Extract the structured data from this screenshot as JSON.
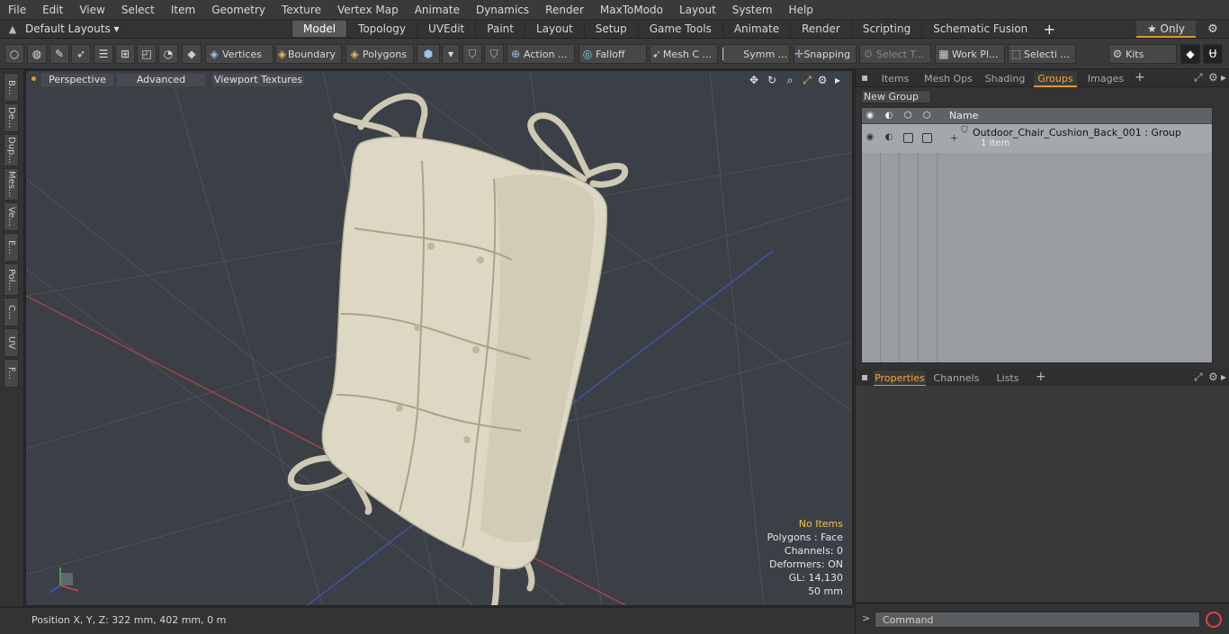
{
  "menu": [
    "File",
    "Edit",
    "View",
    "Select",
    "Item",
    "Geometry",
    "Texture",
    "Vertex Map",
    "Animate",
    "Dynamics",
    "Render",
    "MaxToModo",
    "Layout",
    "System",
    "Help"
  ],
  "layout_bar": {
    "layouts_label": "Default Layouts ▾",
    "tabs": [
      "Model",
      "Topology",
      "UVEdit",
      "Paint",
      "Layout",
      "Setup",
      "Game Tools",
      "Animate",
      "Render",
      "Scripting",
      "Schematic Fusion"
    ],
    "active_tab": "Model",
    "add": "+",
    "only_label": "★ Only"
  },
  "toolbar": {
    "vertices": "Vertices",
    "boundary": "Boundary",
    "polygons": "Polygons",
    "action": "Action ...",
    "falloff": "Falloff",
    "mesh": "Mesh C ...",
    "symm": "Symm ...",
    "snapping": "Snapping",
    "select_t": "Select T...",
    "work_plane": "Work Pl...",
    "selection": "Selecti ...",
    "kits": "Kits"
  },
  "left_tabs": [
    "B...",
    "De...",
    "Dup...",
    "Mes...",
    "Ve...",
    "E...",
    "Pol...",
    "C...",
    "UV",
    "F..."
  ],
  "viewport": {
    "perspective": "Perspective",
    "advanced": "Advanced",
    "viewport_textures": "Viewport Textures",
    "info": {
      "no_items": "No Items",
      "polygons": "Polygons : Face",
      "channels": "Channels: 0",
      "deformers": "Deformers: ON",
      "gl": "GL: 14,130",
      "size": "50 mm"
    }
  },
  "status": {
    "position": "Position X, Y, Z:   322 mm, 402 mm, 0 m"
  },
  "right_panel": {
    "top_tabs": [
      "Items",
      "Mesh Ops",
      "Shading",
      "Groups",
      "Images"
    ],
    "active_top_tab": "Groups",
    "new_group": "New Group",
    "table": {
      "name_header": "Name",
      "row": {
        "name": "Outdoor_Chair_Cushion_Back_001 : Group",
        "sub": "1 Item"
      }
    },
    "bottom_tabs": [
      "Properties",
      "Channels",
      "Lists"
    ],
    "active_bottom_tab": "Properties",
    "command_placeholder": "Command",
    "command_prompt": ">"
  },
  "colors": {
    "accent": "#d99b2b",
    "viewport_bg": "#3b4047",
    "cushion": "#ddd8c4"
  }
}
